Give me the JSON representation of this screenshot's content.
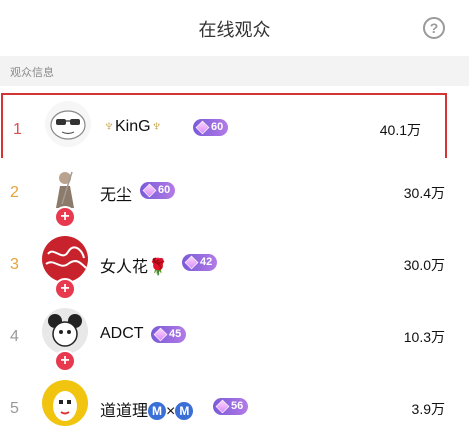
{
  "header": {
    "title": "在线观众",
    "help_icon": "question-circle-icon",
    "help_glyph": "?"
  },
  "section": {
    "label": "观众信息"
  },
  "plus_glyph": "+",
  "viewers": [
    {
      "rank": "1",
      "name_prefix": "♆",
      "name": "KinG",
      "name_suffix": "♆",
      "level": "60",
      "amount": "40.1万"
    },
    {
      "rank": "2",
      "name": "无尘",
      "level": "60",
      "amount": "30.4万"
    },
    {
      "rank": "3",
      "name": "女人花",
      "name_suffix": "🌹",
      "level": "42",
      "amount": "30.0万"
    },
    {
      "rank": "4",
      "name": "ADCT",
      "level": "45",
      "amount": "10.3万"
    },
    {
      "rank": "5",
      "name": "道道理",
      "level": "56",
      "amount": "3.9万",
      "m_left": "M",
      "x_mid": "×",
      "m_right": "M"
    }
  ]
}
